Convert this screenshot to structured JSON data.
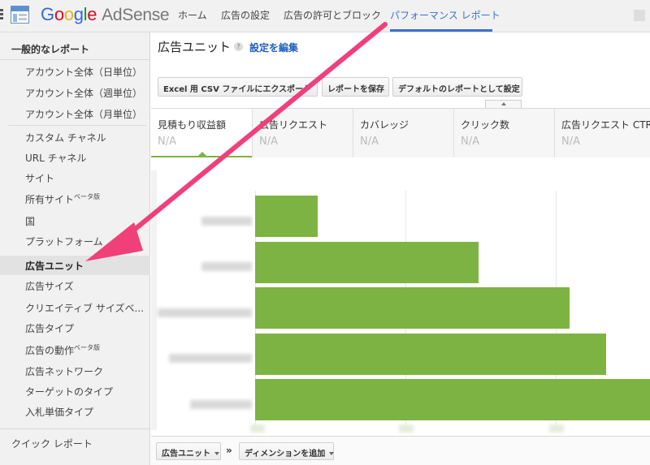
{
  "header": {
    "logo_brand": [
      "G",
      "o",
      "o",
      "g",
      "l",
      "e"
    ],
    "logo_product": "AdSense",
    "nav": [
      {
        "label": "ホーム"
      },
      {
        "label": "広告の設定"
      },
      {
        "label": "広告の許可とブロック"
      },
      {
        "label": "パフォーマンス レポート",
        "active": true
      }
    ]
  },
  "sidebar": {
    "header": "一般的なレポート",
    "items": [
      {
        "label": "アカウント全体（日単位）"
      },
      {
        "label": "アカウント全体（週単位）"
      },
      {
        "label": "アカウント全体（月単位）"
      },
      {
        "label": "カスタム チャネル"
      },
      {
        "label": "URL チャネル"
      },
      {
        "label": "サイト"
      },
      {
        "label": "所有サイト",
        "badge": "ベータ版"
      },
      {
        "label": "国"
      },
      {
        "label": "プラットフォーム"
      },
      {
        "label": "広告ユニット",
        "active": true
      },
      {
        "label": "広告サイズ"
      },
      {
        "label": "クリエイティブ サイズベ..."
      },
      {
        "label": "広告タイプ"
      },
      {
        "label": "広告の動作",
        "badge": "ベータ版"
      },
      {
        "label": "広告ネットワーク"
      },
      {
        "label": "ターゲットのタイプ"
      },
      {
        "label": "入札単価タイプ"
      }
    ],
    "quick_report": "クイック レポート"
  },
  "main": {
    "title": "広告ユニット",
    "help_icon": "?",
    "edit_link": "設定を編集",
    "toolbar": {
      "export_label": "Excel 用 CSV ファイルにエクスポート",
      "save_label": "レポートを保存",
      "default_label": "デフォルトのレポートとして設定"
    },
    "metrics": [
      {
        "label": "見積もり収益額",
        "value": "N/A",
        "selected": true
      },
      {
        "label": "広告リクエスト",
        "value": "N/A"
      },
      {
        "label": "カバレッジ",
        "value": "N/A"
      },
      {
        "label": "クリック数",
        "value": "N/A"
      },
      {
        "label": "広告リクエスト CTR",
        "value": "N/A"
      }
    ],
    "bottom": {
      "dimension_label": "広告ユニット",
      "separator": "»",
      "add_dimension_label": "ディメンションを追加"
    }
  },
  "chart_data": {
    "type": "bar",
    "orientation": "horizontal",
    "categories": [
      "",
      "",
      "",
      "",
      ""
    ],
    "values": [
      0.158,
      0.565,
      0.797,
      0.889,
      1.0
    ],
    "value_note": "category names and axis tick labels are blurred; values are relative bar lengths (longest = 1.0)",
    "bar_color": "#7cb342",
    "grid": true
  },
  "colors": {
    "accent_blue": "#3b6fd4",
    "bar_green": "#7cb342",
    "annotation_pink": "#f0407a"
  }
}
